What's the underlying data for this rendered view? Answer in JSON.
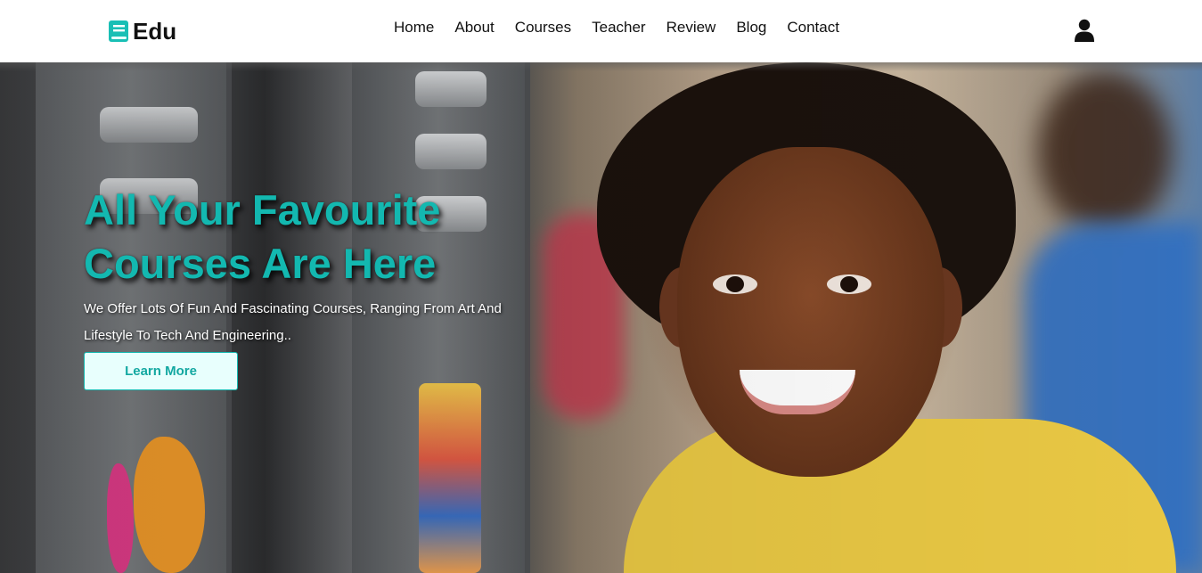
{
  "header": {
    "logo_text": "Edu",
    "logo_icon": "book-icon",
    "user_icon": "user-icon",
    "nav": [
      {
        "label": "Home"
      },
      {
        "label": "About"
      },
      {
        "label": "Courses"
      },
      {
        "label": "Teacher"
      },
      {
        "label": "Review"
      },
      {
        "label": "Blog"
      },
      {
        "label": "Contact"
      }
    ]
  },
  "hero": {
    "title": "All Your Favourite Courses Are Here",
    "description": "We Offer Lots Of Fun And Fascinating Courses, Ranging From Art And Lifestyle To Tech And Engineering..",
    "cta_label": "Learn More"
  },
  "colors": {
    "accent": "#13b8b0",
    "text_dark": "#111111",
    "cta_bg": "#e8fffd"
  }
}
